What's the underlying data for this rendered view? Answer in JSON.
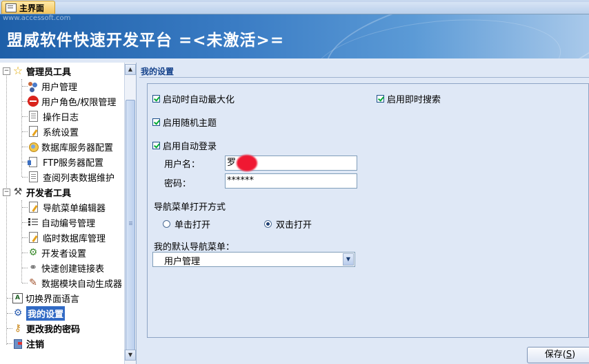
{
  "tab": {
    "label": "主界面"
  },
  "banner": {
    "watermark": "www.accessoft.com",
    "title": "盟威软件快速开发平台 =<未激活>="
  },
  "tree": {
    "admin_tools": "管理员工具",
    "admin_items": [
      "用户管理",
      "用户角色/权限管理",
      "操作日志",
      "系统设置",
      "数据库服务器配置",
      "FTP服务器配置",
      "查阅列表数据维护"
    ],
    "dev_tools": "开发者工具",
    "dev_items": [
      "导航菜单编辑器",
      "自动编号管理",
      "临时数据库管理",
      "开发者设置",
      "快速创建链接表",
      "数据模块自动生成器"
    ],
    "switch_language": "切换界面语言",
    "my_settings": "我的设置",
    "change_password": "更改我的密码",
    "logout": "注销"
  },
  "form": {
    "title": "我的设置",
    "auto_maximize": "启动时自动最大化",
    "instant_search": "启用即时搜索",
    "random_theme": "启用随机主题",
    "auto_login": "启用自动登录",
    "username_label": "用户名：",
    "username_value": "罗",
    "password_label": "密码：",
    "password_value": "******",
    "nav_open_label": "导航菜单打开方式",
    "single_click": "单击打开",
    "double_click": "双击打开",
    "default_nav_label": "我的默认导航菜单：",
    "default_nav_value": "用户管理",
    "save_label": "保存(",
    "save_key": "S",
    "save_close": ")"
  }
}
